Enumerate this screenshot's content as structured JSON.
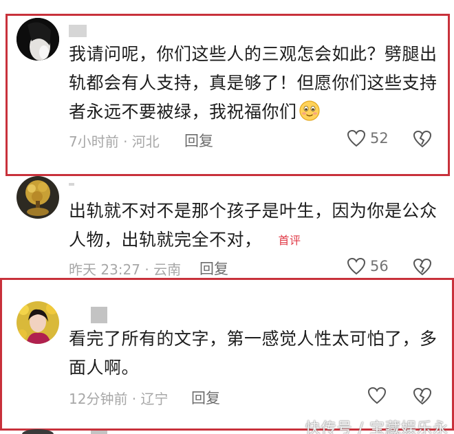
{
  "comments": [
    {
      "text": "我请问呢，你们这些人的三观怎会如此？劈腿出轨都会有人支持，真是够了！但愿你们这些支持者永远不要被绿，我祝福你们",
      "time_location": "7小时前 · 河北",
      "reply_label": "回复",
      "likes": "52",
      "emoji": "blushing-smile-emoji"
    },
    {
      "text": "出轨就不对不是那个孩子是叶生，因为你是公众人物，出轨就完全不对，",
      "badge": "首评",
      "time_location": "昨天 23:27 · 云南",
      "reply_label": "回复",
      "likes": "56"
    },
    {
      "text": "看完了所有的文字，第一感觉人性太可怕了，多面人啊。",
      "time_location": "12分钟前 · 辽宁",
      "reply_label": "回复",
      "likes": ""
    }
  ],
  "watermark": "快传号 / 宝藏娱乐永",
  "colors": {
    "highlight_border": "#c8313b",
    "badge": "#e03a47",
    "meta_text": "#a7a7a7",
    "body_text": "#1d1d1d"
  }
}
